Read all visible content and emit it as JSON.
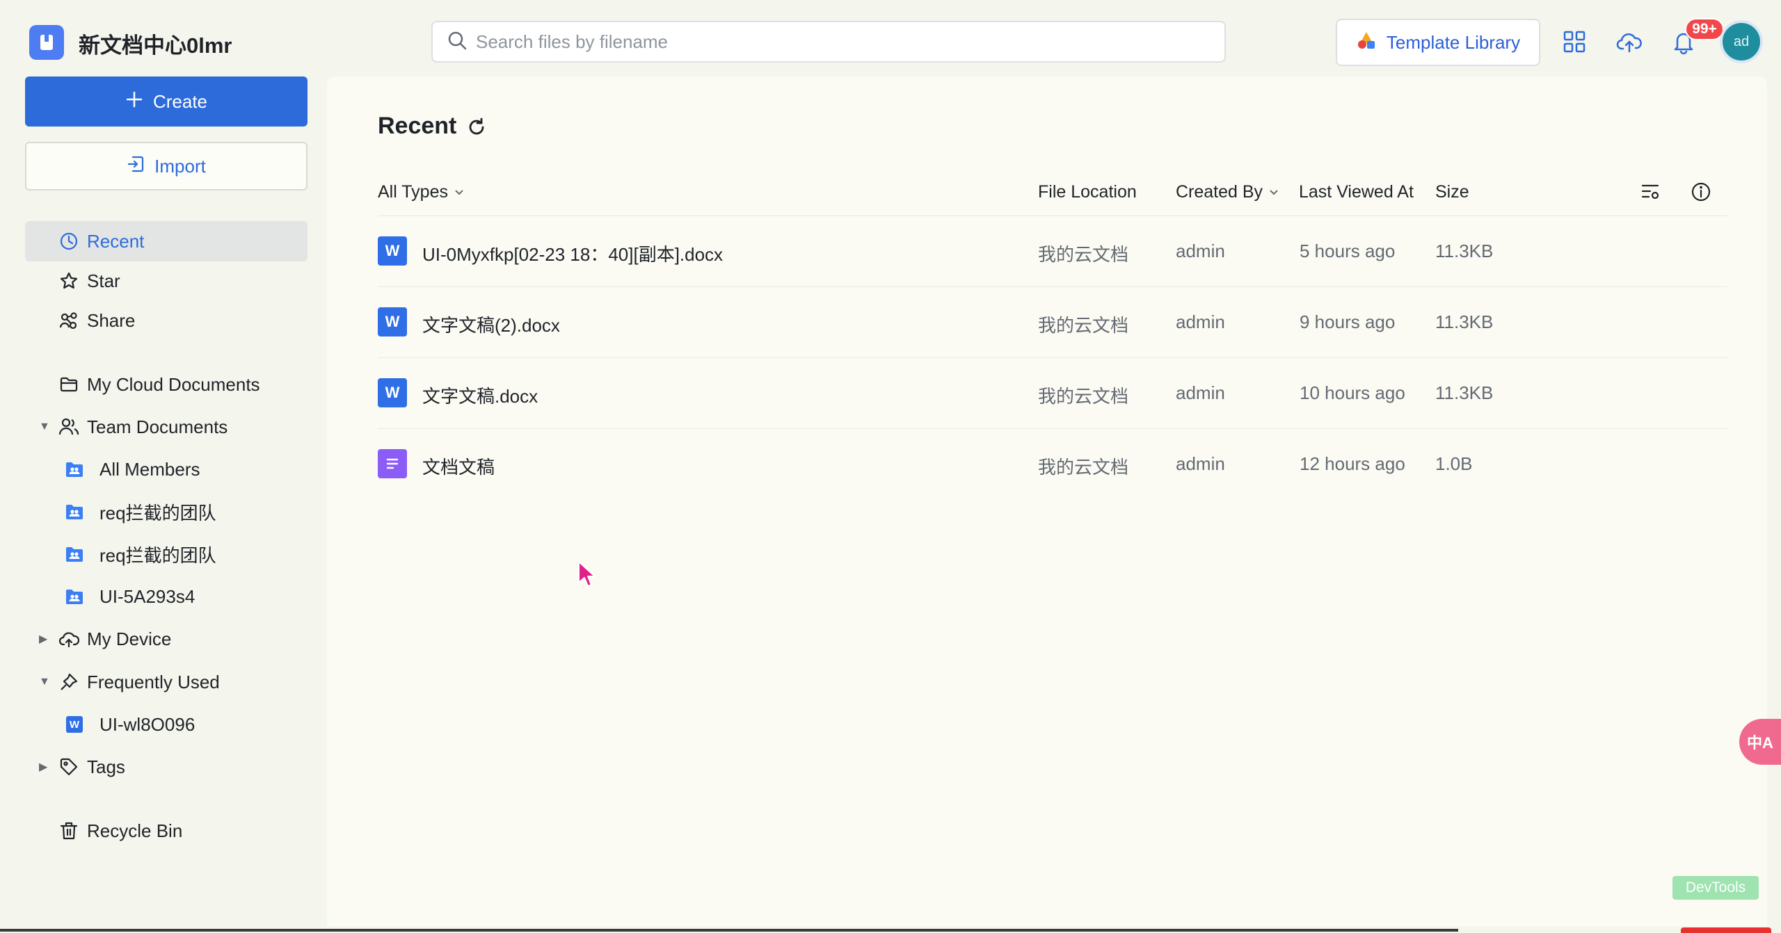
{
  "app": {
    "title": "新文档中心0lmr"
  },
  "search": {
    "placeholder": "Search files by filename",
    "value": ""
  },
  "header": {
    "template_library_label": "Template Library",
    "notification_count": "99+",
    "avatar_text": "ad"
  },
  "sidebar": {
    "create_label": "Create",
    "import_label": "Import",
    "items": [
      {
        "label": "Recent",
        "icon": "clock-icon",
        "active": true
      },
      {
        "label": "Star",
        "icon": "star-icon"
      },
      {
        "label": "Share",
        "icon": "share-icon"
      },
      {
        "label": "My Cloud Documents",
        "icon": "folder-icon"
      },
      {
        "label": "Team Documents",
        "icon": "team-icon",
        "expanded": true
      },
      {
        "label": "All Members",
        "icon": "team-folder-icon"
      },
      {
        "label": "req拦截的团队",
        "icon": "team-folder-icon"
      },
      {
        "label": "req拦截的团队",
        "icon": "team-folder-icon"
      },
      {
        "label": "UI-5A293s4",
        "icon": "team-folder-icon"
      },
      {
        "label": "My Device",
        "icon": "cloud-device-icon",
        "expanded": false
      },
      {
        "label": "Frequently Used",
        "icon": "pin-icon",
        "expanded": true
      },
      {
        "label": "UI-wl8O096",
        "icon": "word-doc-icon"
      },
      {
        "label": "Tags",
        "icon": "tag-icon",
        "expanded": false
      },
      {
        "label": "Recycle Bin",
        "icon": "trash-icon"
      }
    ]
  },
  "main": {
    "title": "Recent",
    "columns": {
      "type_filter": "All Types",
      "location": "File Location",
      "created_by": "Created By",
      "last_viewed": "Last Viewed At",
      "size": "Size"
    },
    "files": [
      {
        "name": "UI-0Myxfkp[02-23 18：40][副本].docx",
        "type": "word",
        "location": "我的云文档",
        "created_by": "admin",
        "last_viewed": "5 hours ago",
        "size": "11.3KB"
      },
      {
        "name": "文字文稿(2).docx",
        "type": "word",
        "location": "我的云文档",
        "created_by": "admin",
        "last_viewed": "9 hours ago",
        "size": "11.3KB"
      },
      {
        "name": "文字文稿.docx",
        "type": "word",
        "location": "我的云文档",
        "created_by": "admin",
        "last_viewed": "10 hours ago",
        "size": "11.3KB"
      },
      {
        "name": "文档文稿",
        "type": "doc",
        "location": "我的云文档",
        "created_by": "admin",
        "last_viewed": "12 hours ago",
        "size": "1.0B"
      }
    ]
  },
  "floating": {
    "translate_label": "中A",
    "devtools_label": "DevTools"
  },
  "colors": {
    "accent": "#2d6bdb",
    "word": "#2f6ee6",
    "doc": "#8b5cf6",
    "badge": "#f0474a"
  }
}
